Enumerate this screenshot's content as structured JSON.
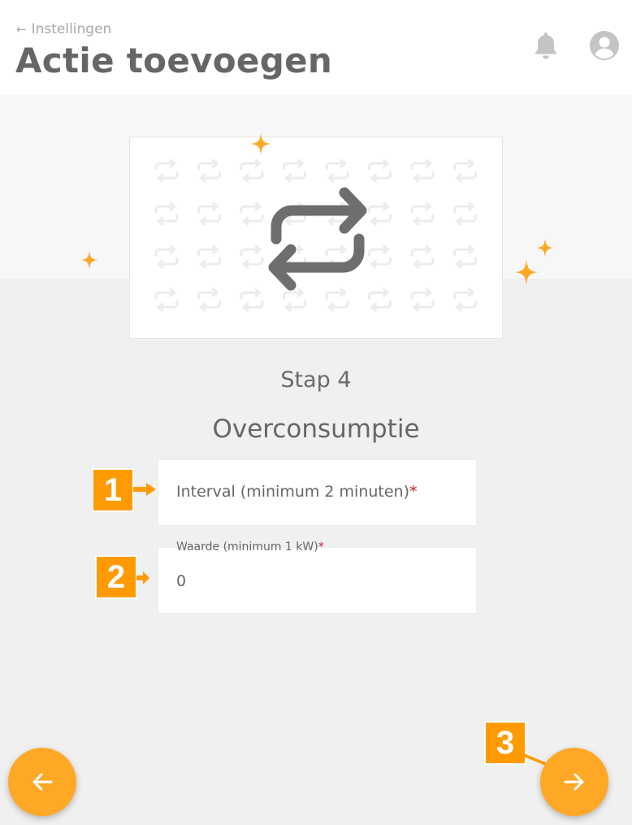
{
  "header": {
    "back_label": "Instellingen",
    "title": "Actie toevoegen",
    "icons": [
      "bell-icon",
      "user-avatar-icon"
    ]
  },
  "hero": {
    "icon": "repeat-icon",
    "pattern_icon": "repeat-icon",
    "sparkle_color": "#ffa826"
  },
  "step": {
    "label": "Stap 4",
    "title": "Overconsumptie"
  },
  "form": {
    "interval": {
      "placeholder": "Interval (minimum 2 minuten)",
      "required_mark": "*"
    },
    "value": {
      "label": "Waarde (minimum 1 kW)",
      "required_mark": "*",
      "value": "0"
    }
  },
  "callouts": [
    "1",
    "2",
    "3"
  ],
  "nav": {
    "back_icon": "arrow-left-icon",
    "next_icon": "arrow-right-icon",
    "accent": "#ffa826"
  }
}
